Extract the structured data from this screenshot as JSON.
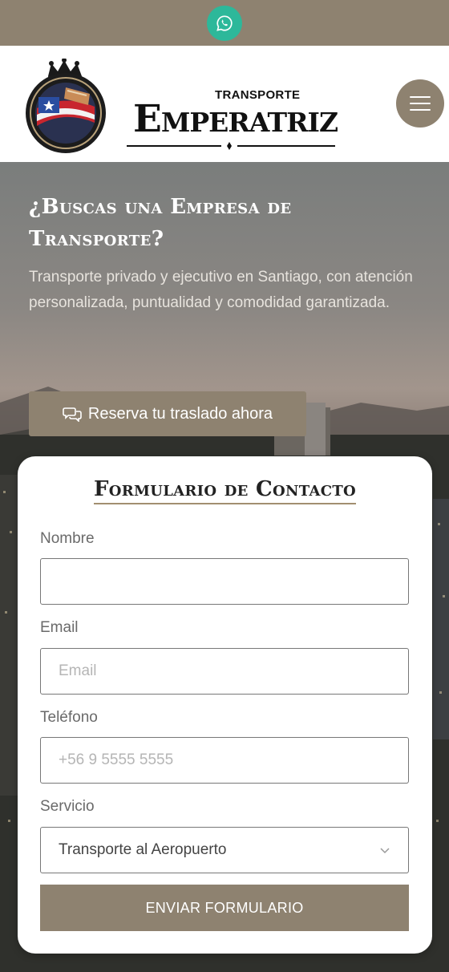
{
  "whatsapp": {
    "icon": "whatsapp-icon"
  },
  "brand": {
    "kicker": "TRANSPORTE",
    "name": "Emperatriz"
  },
  "menu": {
    "icon": "hamburger-menu-icon"
  },
  "hero": {
    "title": "¿Buscas una Empresa de Transporte?",
    "subtitle": "Transporte privado y ejecutivo en Santiago, con atención personalizada, puntualidad y comodidad garantizada.",
    "cta_label": "Reserva tu traslado ahora",
    "cta_icon": "chat-bubbles-icon"
  },
  "form": {
    "title": "Formulario de Contacto",
    "fields": [
      {
        "label": "Nombre",
        "value": "",
        "placeholder": ""
      },
      {
        "label": "Email",
        "value": "",
        "placeholder": "Email"
      },
      {
        "label": "Teléfono",
        "value": "",
        "placeholder": "+56 9 5555 5555"
      },
      {
        "label": "Servicio",
        "value": "Transporte al Aeropuerto"
      }
    ],
    "submit_label": "ENVIAR FORMULARIO"
  },
  "colors": {
    "accent": "#8e8270",
    "whatsapp": "#2db89a",
    "title_underline": "#a28f70"
  }
}
